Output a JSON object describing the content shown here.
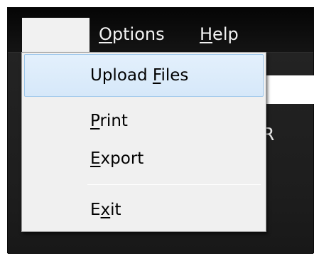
{
  "menubar": {
    "items": [
      {
        "label": "Options",
        "mnemonic": "O"
      },
      {
        "label": "Help",
        "mnemonic": "H"
      }
    ]
  },
  "dropdown": {
    "items": [
      {
        "label_pre": "Upload ",
        "label_mn": "F",
        "label_post": "iles",
        "highlighted": true
      },
      {
        "label_pre": "",
        "label_mn": "P",
        "label_post": "rint",
        "highlighted": false
      },
      {
        "label_pre": "",
        "label_mn": "E",
        "label_post": "xport",
        "highlighted": false
      },
      {
        "label_pre": "E",
        "label_mn": "x",
        "label_post": "it",
        "highlighted": false
      }
    ]
  },
  "content": {
    "partial_text": "R"
  },
  "colors": {
    "menubar_bg": "#0b0b0b",
    "menu_text": "#f2f2f2",
    "dropdown_bg": "#f0f0f0",
    "highlight_bg": "#d6e8f9",
    "highlight_border": "#9cc6eb"
  }
}
